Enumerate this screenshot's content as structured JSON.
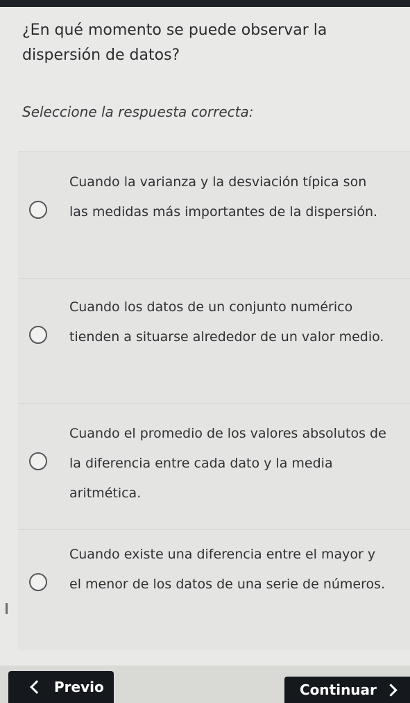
{
  "question": {
    "text": "¿En qué momento se puede observar la dispersión de datos?"
  },
  "instruction": "Seleccione la respuesta correcta:",
  "options": [
    {
      "text": "Cuando la varianza y la desviación típica son las medidas más importantes de la dispersión."
    },
    {
      "text": "Cuando los datos de un conjunto numérico tienden a situarse alrededor de un valor medio."
    },
    {
      "text": "Cuando el promedio de los valores absolutos de la diferencia entre cada dato y la media aritmética."
    },
    {
      "text": "Cuando existe una diferencia entre el mayor y el menor de los datos de una serie de números."
    }
  ],
  "nav": {
    "previous_label": "Previo",
    "next_label": "Continuar"
  },
  "icons": {
    "previous": "chevron-left-icon",
    "next": "chevron-right-icon"
  }
}
